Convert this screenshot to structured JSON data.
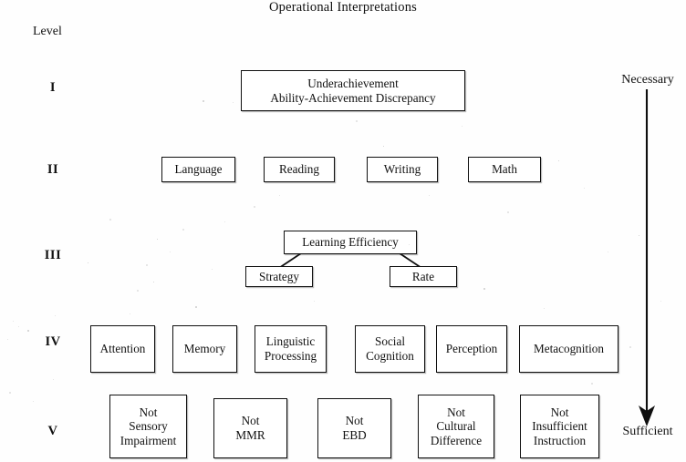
{
  "title": "Operational Interpretations",
  "level_column": {
    "header": "Level",
    "marks": [
      "I",
      "II",
      "III",
      "IV",
      "V"
    ]
  },
  "axis": {
    "top_label": "Necessary",
    "bottom_label": "Sufficient",
    "direction": "down"
  },
  "levels": [
    {
      "mark": "I",
      "nodes": [
        {
          "label": "Underachievement\nAbility-Achievement Discrepancy"
        }
      ]
    },
    {
      "mark": "II",
      "nodes": [
        {
          "label": "Language"
        },
        {
          "label": "Reading"
        },
        {
          "label": "Writing"
        },
        {
          "label": "Math"
        }
      ]
    },
    {
      "mark": "III",
      "nodes": [
        {
          "label": "Learning Efficiency"
        },
        {
          "label": "Strategy"
        },
        {
          "label": "Rate"
        }
      ]
    },
    {
      "mark": "IV",
      "nodes": [
        {
          "label": "Attention"
        },
        {
          "label": "Memory"
        },
        {
          "label": "Linguistic\nProcessing"
        },
        {
          "label": "Social\nCognition"
        },
        {
          "label": "Perception"
        },
        {
          "label": "Metacognition"
        }
      ]
    },
    {
      "mark": "V",
      "nodes": [
        {
          "label": "Not\nSensory\nImpairment"
        },
        {
          "label": "Not\nMMR"
        },
        {
          "label": "Not\nEBD"
        },
        {
          "label": "Not\nCultural\nDifference"
        },
        {
          "label": "Not\nInsufficient\nInstruction"
        }
      ]
    }
  ],
  "colors": {
    "ink": "#101010",
    "paper": "#fefefe"
  }
}
